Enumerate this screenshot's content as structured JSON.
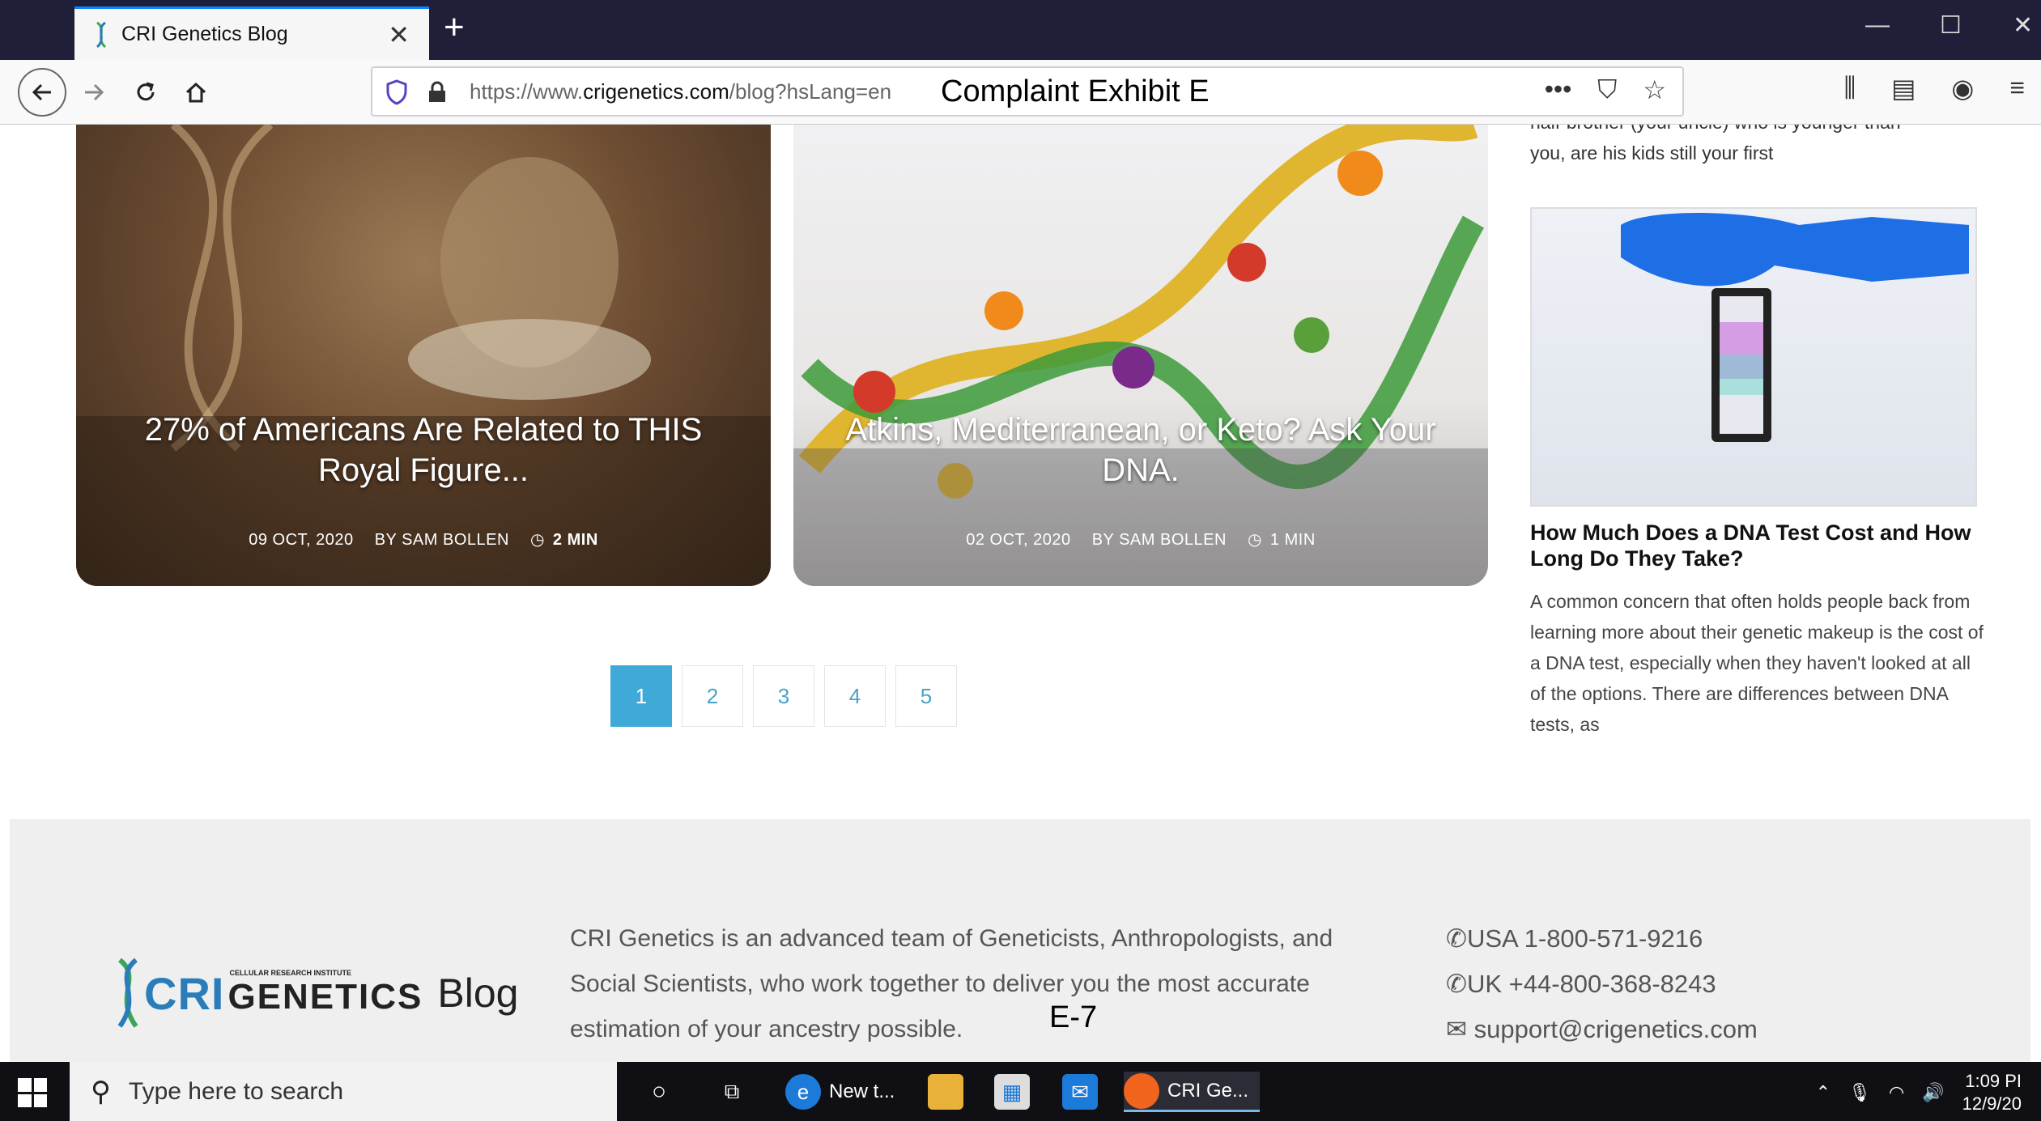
{
  "browser": {
    "tab_title": "CRI Genetics Blog",
    "tab_close": "✕",
    "new_tab": "+",
    "url_prefix": "https://www.",
    "url_domain": "crigenetics.com",
    "url_suffix": "/blog?hsLang=en",
    "url_overlay": "Complaint Exhibit E"
  },
  "cards": [
    {
      "title": "27% of Americans Are Related to THIS Royal Figure...",
      "date": "09 OCT, 2020",
      "author": "BY SAM BOLLEN",
      "read": "2 MIN"
    },
    {
      "title": "Atkins, Mediterranean, or Keto? Ask Your DNA.",
      "date": "02 OCT, 2020",
      "author": "BY SAM BOLLEN",
      "read": "1 MIN"
    }
  ],
  "pagination": [
    "1",
    "2",
    "3",
    "4",
    "5"
  ],
  "sidebar": {
    "top_text_1": "half-brother (your uncle) who is younger than",
    "top_text_2": "you, are his kids still your first",
    "title": "How Much Does a DNA Test Cost and How Long Do They Take?",
    "body": "A common concern that often holds people back from learning more about their genetic makeup is the cost of a DNA test, especially when they haven't looked at all of the options. There are differences between DNA tests, as"
  },
  "footer": {
    "logo_cri": "CRI",
    "logo_small": "CELLULAR RESEARCH INSTITUTE",
    "logo_genetics": "GENETICS",
    "logo_blog": "Blog",
    "about": "CRI Genetics is an advanced team of Geneticists, Anthropologists, and Social Scientists, who work together to deliver you the most accurate estimation of your ancestry possible.",
    "phone_usa": "USA 1-800-571-9216",
    "phone_uk": "UK +44-800-368-8243",
    "email": "support@crigenetics.com"
  },
  "exhibit_label": "E-7",
  "taskbar": {
    "search_placeholder": "Type here to search",
    "edge_label": "New t...",
    "firefox_label": "CRI Ge...",
    "time": "1:09 PI",
    "date": "12/9/20"
  },
  "colors": {
    "accent": "#3fa9d8",
    "logo_blue": "#2a7db8",
    "tab_bar": "#1f1f3a"
  }
}
